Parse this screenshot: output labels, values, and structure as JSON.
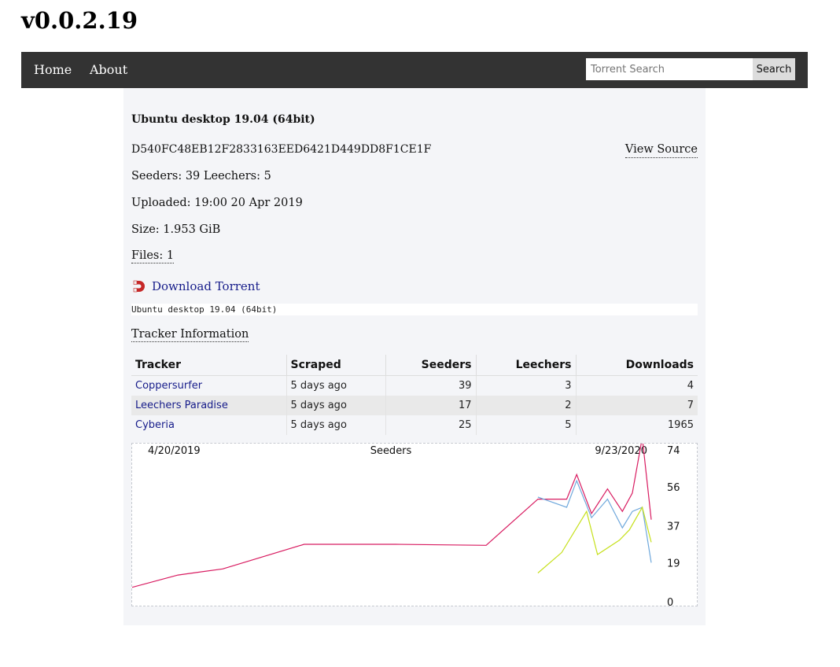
{
  "site": {
    "version": "v0.0.2.19"
  },
  "nav": {
    "home": "Home",
    "about": "About"
  },
  "search": {
    "placeholder": "Torrent Search",
    "value": "",
    "button": "Search"
  },
  "torrent": {
    "title": "Ubuntu desktop 19.04 (64bit)",
    "info_hash": "D540FC48EB12F2833163EED6421D449DD8F1CE1F",
    "view_source": "View Source",
    "seeders_line": "Seeders: 39 Leechers: 5",
    "uploaded_line": "Uploaded: 19:00 20 Apr 2019",
    "size_line": "Size: 1.953 GiB",
    "files_link": "Files: 1",
    "download_label": "Download Torrent",
    "download_icon": "magnet-icon",
    "files": [
      "Ubuntu desktop 19.04 (64bit)"
    ]
  },
  "trackers": {
    "heading": "Tracker Information",
    "columns": [
      "Tracker",
      "Scraped",
      "Seeders",
      "Leechers",
      "Downloads"
    ],
    "rows": [
      {
        "tracker": "Coppersurfer",
        "scraped": "5 days ago",
        "seeders": "39",
        "leechers": "3",
        "downloads": "4"
      },
      {
        "tracker": "Leechers Paradise",
        "scraped": "5 days ago",
        "seeders": "17",
        "leechers": "2",
        "downloads": "7"
      },
      {
        "tracker": "Cyberia",
        "scraped": "5 days ago",
        "seeders": "25",
        "leechers": "5",
        "downloads": "1965"
      }
    ]
  },
  "colors": {
    "navbar": "#333333",
    "panel": "#f4f5f8",
    "link": "#161c8a",
    "series_total": "#d81b60",
    "series_blue": "#6fa8dc",
    "series_green": "#c6e01b"
  },
  "chart_data": {
    "type": "line",
    "title": "Seeders",
    "x_start_label": "4/20/2019",
    "x_end_label": "9/23/2020",
    "xlim": [
      "2019-04-20",
      "2020-09-23"
    ],
    "ylim": [
      0,
      74
    ],
    "y_ticks": [
      0,
      19,
      37,
      56,
      74
    ],
    "grid": false,
    "legend": "none",
    "series": [
      {
        "color": "#d81b60",
        "points": [
          [
            "2019-04-20",
            7
          ],
          [
            "2019-06-05",
            13
          ],
          [
            "2019-07-20",
            16
          ],
          [
            "2019-10-10",
            28
          ],
          [
            "2020-01-10",
            28
          ],
          [
            "2020-04-10",
            27.5
          ],
          [
            "2020-06-01",
            50
          ],
          [
            "2020-06-30",
            50
          ],
          [
            "2020-07-10",
            62
          ],
          [
            "2020-07-25",
            43
          ],
          [
            "2020-08-10",
            55
          ],
          [
            "2020-08-25",
            44
          ],
          [
            "2020-09-04",
            53
          ],
          [
            "2020-09-14",
            80
          ],
          [
            "2020-09-23",
            40
          ]
        ]
      },
      {
        "color": "#6fa8dc",
        "points": [
          [
            "2020-06-01",
            51
          ],
          [
            "2020-06-30",
            46
          ],
          [
            "2020-07-10",
            59
          ],
          [
            "2020-07-25",
            41
          ],
          [
            "2020-08-10",
            50
          ],
          [
            "2020-08-25",
            36
          ],
          [
            "2020-09-04",
            44
          ],
          [
            "2020-09-14",
            46
          ],
          [
            "2020-09-23",
            19
          ]
        ]
      },
      {
        "color": "#c6e01b",
        "points": [
          [
            "2020-06-01",
            14
          ],
          [
            "2020-06-25",
            24
          ],
          [
            "2020-07-20",
            44
          ],
          [
            "2020-07-31",
            23
          ],
          [
            "2020-08-22",
            30
          ],
          [
            "2020-09-01",
            35
          ],
          [
            "2020-09-14",
            46
          ],
          [
            "2020-09-23",
            29
          ]
        ]
      }
    ]
  }
}
